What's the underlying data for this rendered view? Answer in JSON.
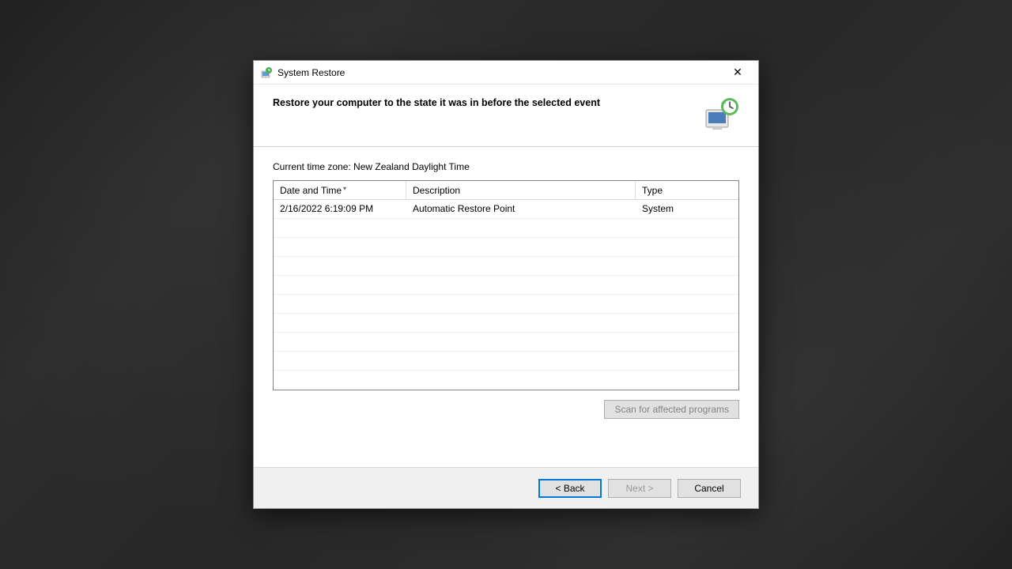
{
  "titlebar": {
    "title": "System Restore",
    "close_label": "✕"
  },
  "header": {
    "title": "Restore your computer to the state it was in before the selected event"
  },
  "content": {
    "timezone_label": "Current time zone: New Zealand Daylight Time",
    "columns": {
      "date": "Date and Time",
      "description": "Description",
      "type": "Type"
    },
    "rows": [
      {
        "date": "2/16/2022 6:19:09 PM",
        "description": "Automatic Restore Point",
        "type": "System"
      }
    ],
    "scan_button": "Scan for affected programs"
  },
  "footer": {
    "back": "< Back",
    "next": "Next >",
    "cancel": "Cancel"
  }
}
